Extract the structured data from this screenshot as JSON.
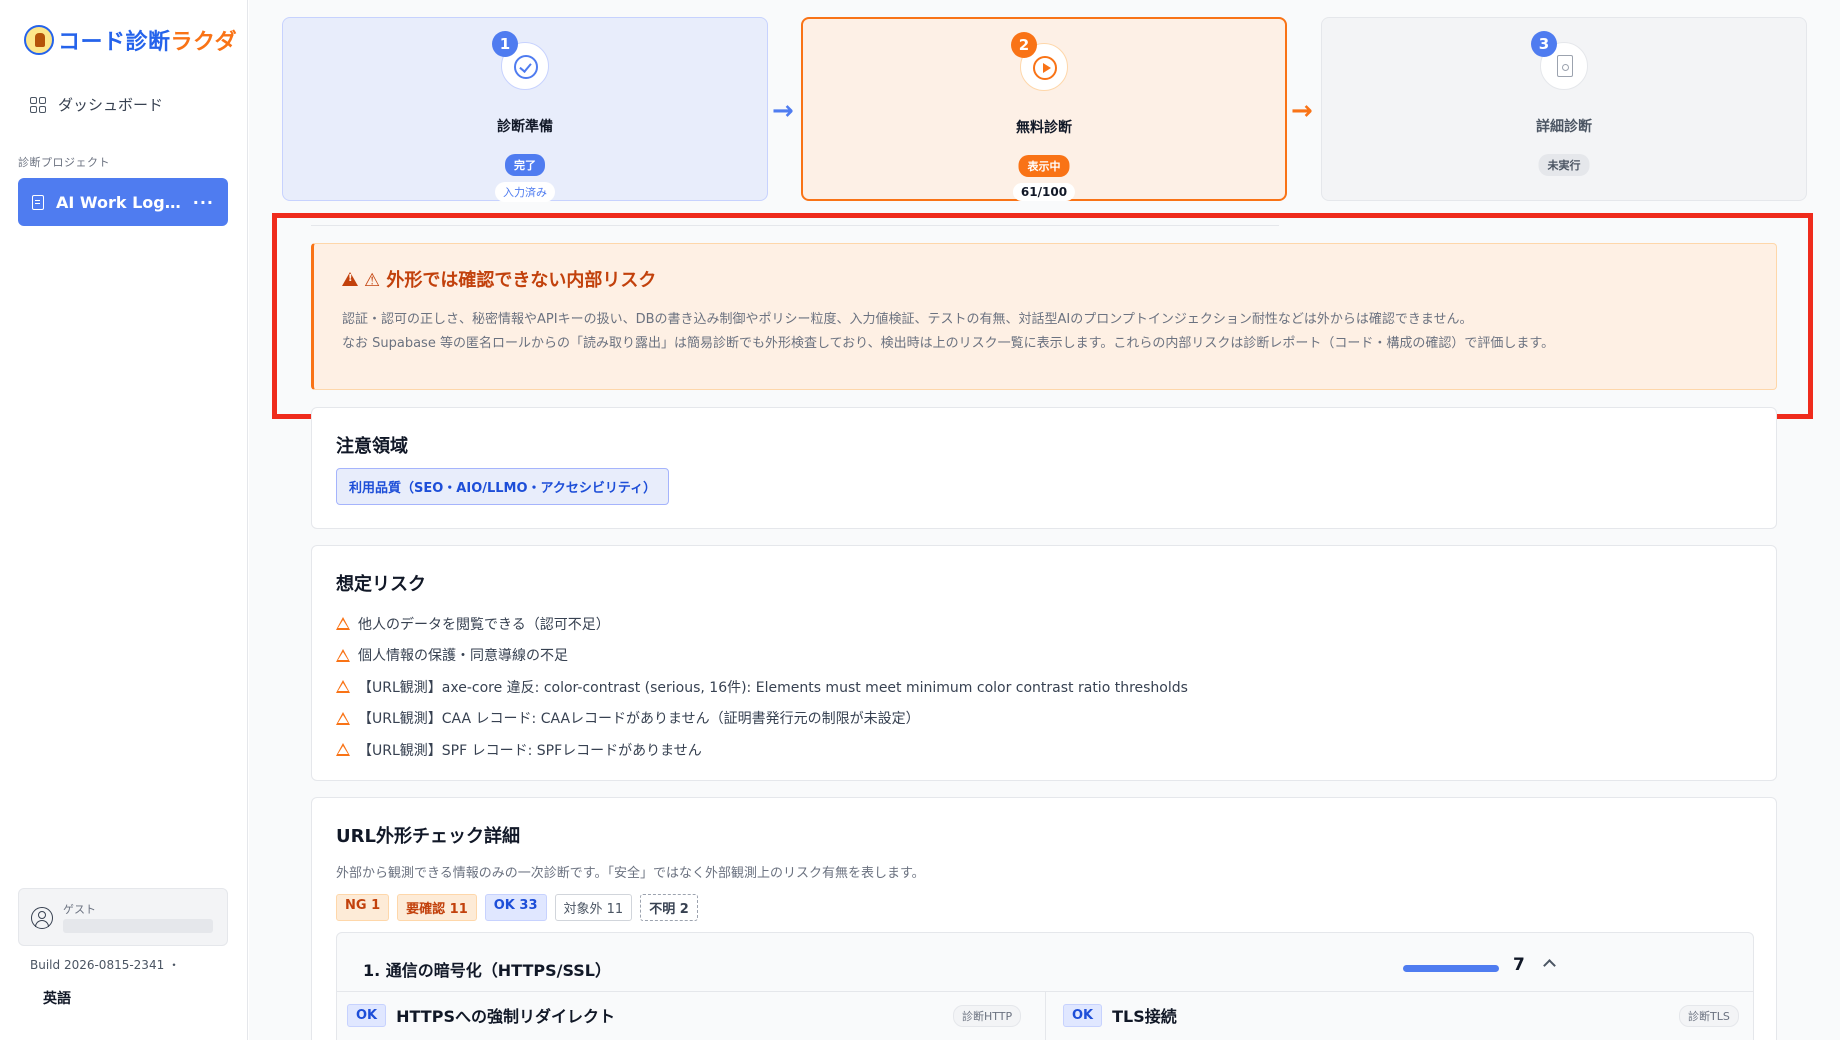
{
  "app": {
    "logo_part1": "コード診断",
    "logo_part2": "ラクダ"
  },
  "sidebar": {
    "dashboard_label": "ダッシュボード",
    "section_label": "診断プロジェクト",
    "project_label": "AI Work Log…",
    "more_label": "···",
    "guest_label": "ゲスト",
    "build_label": "Build 2026-0815-2341 ・",
    "language_label": "英語"
  },
  "steps": [
    {
      "num": "1",
      "title": "診断準備",
      "badge": "完了",
      "sub": "入力済み"
    },
    {
      "num": "2",
      "title": "無料診断",
      "badge": "表示中",
      "sub": "61/100"
    },
    {
      "num": "3",
      "title": "詳細診断",
      "badge": "未実行",
      "sub": ""
    }
  ],
  "arrows": {
    "a1": "→",
    "a2": "→"
  },
  "internal_risk": {
    "title": "⚠ 外形では確認できない内部リスク",
    "line1": "認証・認可の正しさ、秘密情報やAPIキーの扱い、DBの書き込み制御やポリシー粒度、入力値検証、テストの有無、対話型AIのプロンプトインジェクション耐性などは外からは確認できません。",
    "line2": "なお Supabase 等の匿名ロールからの「読み取り露出」は簡易診断でも外形検査しており、検出時は上のリスク一覧に表示します。これらの内部リスクは診断レポート（コード・構成の確認）で評価します。"
  },
  "attention": {
    "title": "注意領域",
    "chip": "利用品質（SEO・AIO/LLMO・アクセシビリティ）"
  },
  "risks": {
    "title": "想定リスク",
    "items": [
      "他人のデータを閲覧できる（認可不足）",
      "個人情報の保護・同意導線の不足",
      "【URL観測】axe-core 違反: color-contrast (serious, 16件): Elements must meet minimum color contrast ratio thresholds",
      "【URL観測】CAA レコード: CAAレコードがありません（証明書発行元の制限が未設定）",
      "【URL観測】SPF レコード: SPFレコードがありません"
    ]
  },
  "url_check": {
    "title": "URL外形チェック詳細",
    "description": "外部から観測できる情報のみの一次診断です。「安全」ではなく外部観測上のリスク有無を表します。",
    "counts": {
      "ng": "NG 1",
      "recheck": "要確認 11",
      "ok": "OK 33",
      "excluded": "対象外 11",
      "unknown": "不明 2"
    },
    "section": {
      "title": "1. 通信の暗号化（HTTPS/SSL）",
      "score": "7",
      "progress": 1.0,
      "items": [
        {
          "badge": "OK",
          "label": "HTTPSへの強制リダイレクト",
          "tag": "診断HTTP"
        },
        {
          "badge": "OK",
          "label": "TLS接続",
          "tag": "診断TLS"
        }
      ]
    }
  },
  "colors": {
    "primary": "#4f7cf0",
    "accent": "#f97316",
    "highlight_outline": "#ef2b1c"
  }
}
